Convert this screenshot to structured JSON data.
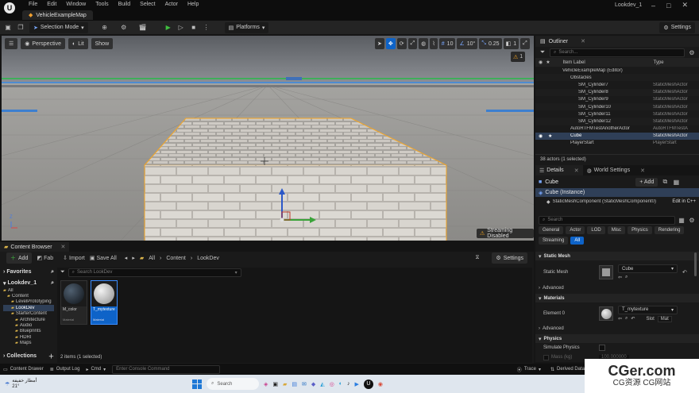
{
  "title_bar": {
    "menu": [
      "File",
      "Edit",
      "Window",
      "Tools",
      "Build",
      "Select",
      "Actor",
      "Help"
    ],
    "project_name": "Lookdev_1",
    "map_tab": "VehicleExampleMap"
  },
  "toolbar": {
    "selection_mode": "Selection Mode",
    "platforms": "Platforms",
    "settings": "Settings"
  },
  "viewport": {
    "perspective": "Perspective",
    "lit": "Lit",
    "show": "Show",
    "grid_size": "10",
    "rotation_snap": "10°",
    "scale_snap": "0.25",
    "camera_speed": "1",
    "realtime_badge": "1",
    "streaming_notice": "Streaming Disabled",
    "axis_label": "Z"
  },
  "outliner": {
    "title": "Outliner",
    "search_placeholder": "Search...",
    "col_label": "Item Label",
    "col_type": "Type",
    "rows": [
      {
        "label": "VehicleExampleMap (Editor)",
        "type": "",
        "indent": 0,
        "selected": false
      },
      {
        "label": "Obstacles",
        "type": "",
        "indent": 1,
        "selected": false
      },
      {
        "label": "SM_Cylinder7",
        "type": "StaticMeshActor",
        "indent": 2,
        "selected": false
      },
      {
        "label": "SM_Cylinder8",
        "type": "StaticMeshActor",
        "indent": 2,
        "selected": false
      },
      {
        "label": "SM_Cylinder9",
        "type": "StaticMeshActor",
        "indent": 2,
        "selected": false
      },
      {
        "label": "SM_Cylinder10",
        "type": "StaticMeshActor",
        "indent": 2,
        "selected": false
      },
      {
        "label": "SM_Cylinder11",
        "type": "StaticMeshActor",
        "indent": 2,
        "selected": false
      },
      {
        "label": "SM_Cylinder12",
        "type": "StaticMeshActor",
        "indent": 2,
        "selected": false
      },
      {
        "label": "AutoRTFMTestAnotherActor",
        "type": "AutoRTFMTestA",
        "indent": 1,
        "selected": false
      },
      {
        "label": "Cube",
        "type": "StaticMeshActor",
        "indent": 1,
        "selected": true
      },
      {
        "label": "PlayerStart",
        "type": "PlayerStart",
        "indent": 1,
        "selected": false
      }
    ],
    "footer": "38 actors (1 selected)"
  },
  "details": {
    "tab_details": "Details",
    "tab_world": "World Settings",
    "actor_name": "Cube",
    "add_label": "+ Add",
    "instance_label": "Cube (Instance)",
    "component_label": "StaticMeshComponent (StaticMeshComponent0)",
    "edit_cpp": "Edit in C++",
    "search_placeholder": "Search",
    "filters_row1": [
      "General",
      "Actor",
      "LOD",
      "Misc",
      "Physics",
      "Rendering"
    ],
    "filters_row2": [
      "Streaming",
      "All"
    ],
    "section_static_mesh": "Static Mesh",
    "static_mesh_label": "Static Mesh",
    "static_mesh_value": "Cube",
    "advanced": "Advanced",
    "section_materials": "Materials",
    "element_label": "Element 0",
    "material_value": "T_mytexture",
    "slot_label": "Slot",
    "slot_value": "Mat",
    "section_physics": "Physics",
    "simulate_physics": "Simulate Physics",
    "mass_label": "Mass (kg)",
    "mass_value": "100.000000"
  },
  "content_browser": {
    "title": "Content Browser",
    "add": "Add",
    "fab": "Fab",
    "import": "Import",
    "save_all": "Save All",
    "breadcrumb": [
      "All",
      "Content",
      "LookDev"
    ],
    "settings": "Settings",
    "search_placeholder": "Search LookDev",
    "favorites": "Favorites",
    "project_root": "Lookdev_1",
    "tree": [
      {
        "label": "All",
        "indent": 0,
        "selected": false
      },
      {
        "label": "Content",
        "indent": 1,
        "selected": false
      },
      {
        "label": "LevelPrototyping",
        "indent": 2,
        "selected": false
      },
      {
        "label": "LookDev",
        "indent": 2,
        "selected": true
      },
      {
        "label": "StarterContent",
        "indent": 2,
        "selected": false
      },
      {
        "label": "Architecture",
        "indent": 3,
        "selected": false
      },
      {
        "label": "Audio",
        "indent": 3,
        "selected": false
      },
      {
        "label": "Blueprints",
        "indent": 3,
        "selected": false
      },
      {
        "label": "HDRI",
        "indent": 3,
        "selected": false
      },
      {
        "label": "Maps",
        "indent": 3,
        "selected": false
      }
    ],
    "collections": "Collections",
    "assets": [
      {
        "name": "M_color",
        "kind": "Material",
        "selected": false
      },
      {
        "name": "T_mytexture",
        "kind": "Material",
        "selected": true
      }
    ],
    "status": "2 items (1 selected)"
  },
  "status_bar": {
    "content_drawer": "Content Drawer",
    "output_log": "Output Log",
    "cmd": "Cmd",
    "console_placeholder": "Enter Console Command",
    "trace": "Trace",
    "derived_data": "Derived Data"
  },
  "taskbar": {
    "search": "Search",
    "weather_line1": "أمطار خفيفة",
    "weather_line2": "21°"
  },
  "watermark": {
    "line1": "CGer.com",
    "line2": "CG资源 CG网站"
  },
  "colors": {
    "accent_blue": "#0e63c8",
    "selection_orange": "#f5a623",
    "play_green": "#3fbf3f"
  }
}
